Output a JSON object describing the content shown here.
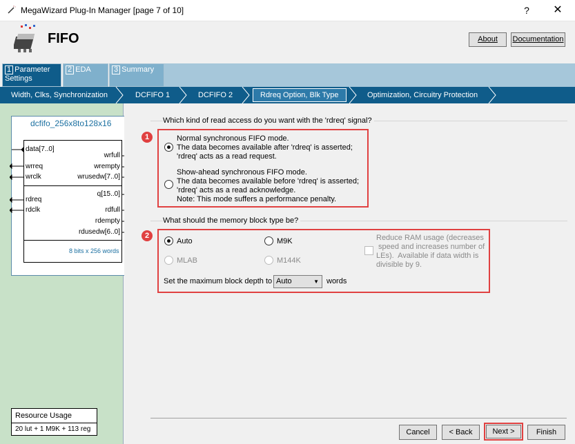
{
  "window": {
    "title": "MegaWizard Plug-In Manager [page 7 of 10]",
    "help_glyph": "?",
    "close_glyph": "✕"
  },
  "header": {
    "title": "FIFO",
    "about_label": "About",
    "documentation_label": "Documentation"
  },
  "tabs": [
    {
      "num": "1",
      "label": "Parameter Settings"
    },
    {
      "num": "2",
      "label": "EDA"
    },
    {
      "num": "3",
      "label": "Summary"
    }
  ],
  "breadcrumbs": [
    "Width, Clks, Synchronization",
    "DCFIFO 1",
    "DCFIFO 2",
    "Rdreq Option, Blk Type",
    "Optimization, Circuitry Protection"
  ],
  "diagram": {
    "title": "dcfifo_256x8to128x16",
    "left_pins": [
      "data[7..0]",
      "wrreq",
      "wrclk",
      "rdreq",
      "rdclk"
    ],
    "right_pins": [
      "wrfull",
      "wrempty",
      "wrusedw[7..0]",
      "q[15..0]",
      "rdfull",
      "rdempty",
      "rdusedw[6..0]"
    ],
    "footer": "8 bits x 256 words"
  },
  "resource": {
    "title": "Resource Usage",
    "value": "20 lut + 1 M9K + 113 reg"
  },
  "read_access": {
    "question": "Which kind of read access do you want with the 'rdreq' signal?",
    "marker": "1",
    "option1": {
      "line1": "Normal synchronous FIFO mode.",
      "line2": "The data becomes available after 'rdreq' is asserted;",
      "line3": "'rdreq' acts as a read request.",
      "selected": true
    },
    "option2": {
      "line1": "Show-ahead synchronous FIFO mode.",
      "line2": "The data becomes available before 'rdreq' is asserted;",
      "line3": "'rdreq' acts as a read acknowledge.",
      "line4": "Note: This mode suffers a performance penalty.",
      "selected": false
    }
  },
  "memory_block": {
    "question": "What should the memory block type be?",
    "marker": "2",
    "options": {
      "auto": "Auto",
      "m9k": "M9K",
      "mlab": "MLAB",
      "m144k": "M144K"
    },
    "selected": "Auto",
    "reduce_ram": {
      "line1": "Reduce RAM usage (decreases",
      "line2": " speed and increases number of",
      "line3": "LEs).  Available if data width is",
      "line4": "divisible by 9."
    },
    "depth_label": "Set the maximum block depth to",
    "depth_value": "Auto",
    "depth_unit": "words"
  },
  "footer_buttons": {
    "cancel": "Cancel",
    "back": "< Back",
    "next": "Next >",
    "finish": "Finish"
  },
  "colors": {
    "accent": "#0f5c8a",
    "highlight": "#e04040",
    "left_panel": "#c8e1c8"
  }
}
